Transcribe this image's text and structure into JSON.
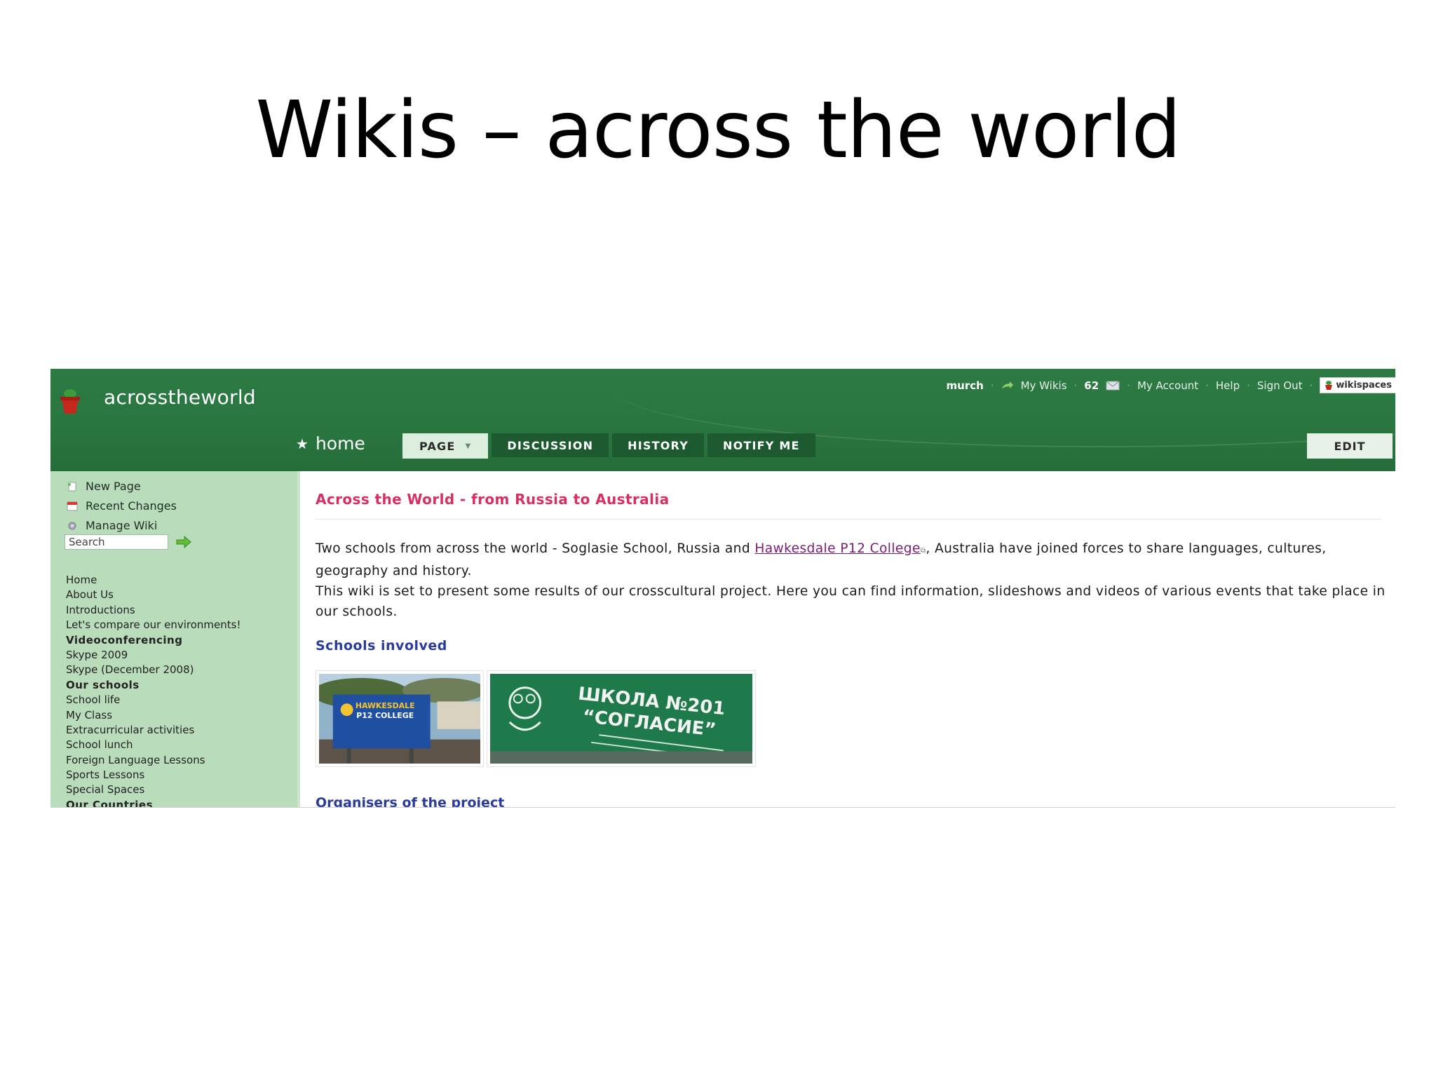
{
  "slide": {
    "title": "Wikis – across the world"
  },
  "site": {
    "name": "acrosstheworld"
  },
  "userbar": {
    "username": "murch",
    "my_wikis": "My Wikis",
    "message_count": "62",
    "my_account": "My Account",
    "help": "Help",
    "sign_out": "Sign Out",
    "brand_badge": "wikispaces"
  },
  "tabs": {
    "home": "home",
    "page": "PAGE",
    "discussion": "DISCUSSION",
    "history": "HISTORY",
    "notify": "NOTIFY ME",
    "edit": "EDIT"
  },
  "sidebar": {
    "actions": {
      "new_page": "New Page",
      "recent_changes": "Recent Changes",
      "manage_wiki": "Manage Wiki"
    },
    "search_placeholder": "Search",
    "nav": [
      "Home",
      "About Us",
      "Introductions",
      "Let's compare our environments!",
      "Videoconferencing",
      "Skype 2009",
      "Skype (December 2008)",
      "Our schools",
      "School life",
      "My Class",
      "Extracurricular activities",
      "School lunch",
      "Foreign Language Lessons",
      "Sports Lessons",
      "Special Spaces",
      "Our Countries"
    ]
  },
  "main": {
    "heading": "Across the World - from Russia to Australia",
    "para1_before": "Two schools from across the world - Soglasie School, Russia and ",
    "para1_link": "Hawkesdale P12 College",
    "para1_after": ", Australia have joined forces to share languages, cultures, geography and history.",
    "para2": "This wiki is set to present some results of our crosscultural project. Here you can find information, slideshows and videos of various events that take place in our schools.",
    "schools_heading": "Schools involved",
    "photo1_sign": [
      "HAWKESDALE",
      "P12 COLLEGE"
    ],
    "photo2_sign": [
      "ШКОЛА №201",
      "“СОГЛАСИЕ”"
    ],
    "cut_heading": "Organisers of the project"
  },
  "colors": {
    "header_green": "#2a7640",
    "sidebar_green": "#b9dcbb",
    "heading_pink": "#d63062",
    "subheading_blue": "#2a3b9c",
    "link_purple": "#7a1c73"
  }
}
